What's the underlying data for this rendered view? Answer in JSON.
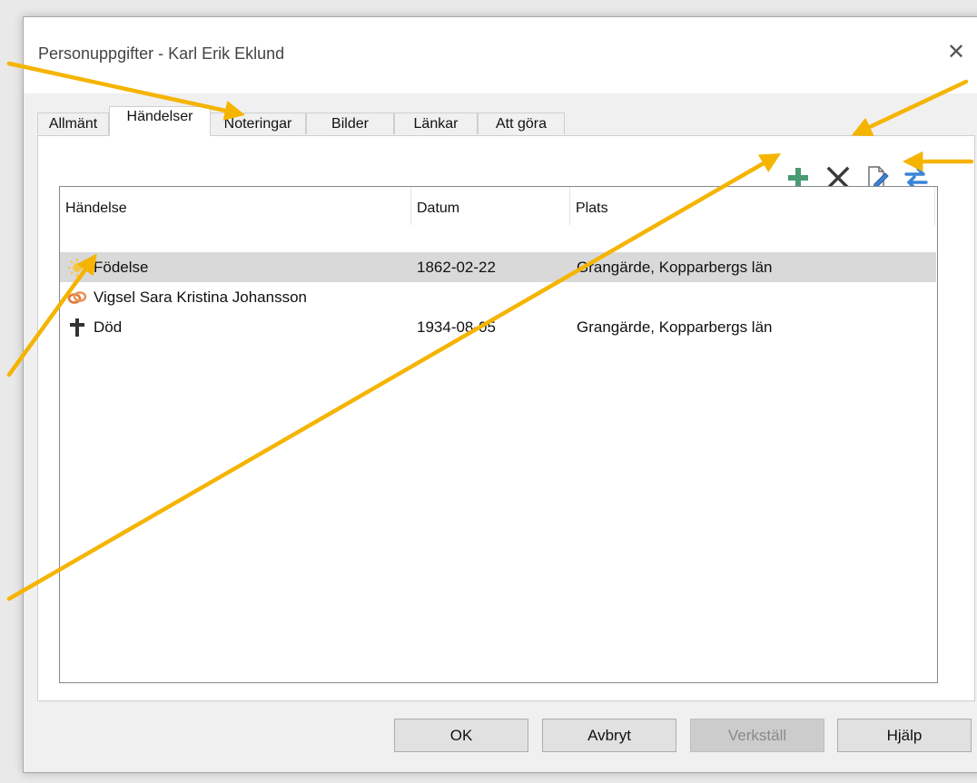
{
  "window": {
    "title": "Personuppgifter - Karl Erik Eklund",
    "close_glyph": "✕"
  },
  "tabs": [
    {
      "label": "Allmänt",
      "active": false
    },
    {
      "label": "Händelser",
      "active": true
    },
    {
      "label": "Noteringar",
      "active": false
    },
    {
      "label": "Bilder",
      "active": false
    },
    {
      "label": "Länkar",
      "active": false
    },
    {
      "label": "Att göra",
      "active": false
    }
  ],
  "toolbar": {
    "icons": [
      "add-icon",
      "delete-icon",
      "edit-icon",
      "swap-icon"
    ]
  },
  "events_table": {
    "columns": [
      "Händelse",
      "Datum",
      "Plats"
    ],
    "rows": [
      {
        "icon": "birth-sun-icon",
        "event": "Födelse",
        "date": "1862-02-22",
        "place": "Grangärde, Kopparbergs län",
        "selected": true
      },
      {
        "icon": "marriage-rings-icon",
        "event": "Vigsel Sara Kristina Johansson",
        "date": "",
        "place": "",
        "selected": false
      },
      {
        "icon": "death-cross-icon",
        "event": "Död",
        "date": "1934-08-05",
        "place": "Grangärde, Kopparbergs län",
        "selected": false
      }
    ]
  },
  "buttons": {
    "ok": "OK",
    "cancel": "Avbryt",
    "apply": "Verkställ",
    "help": "Hjälp"
  },
  "colors": {
    "arrow": "#f5b400",
    "selection": "#d9d9d9",
    "add_icon": "#4a9a72",
    "swap_icon": "#3b84d6"
  }
}
